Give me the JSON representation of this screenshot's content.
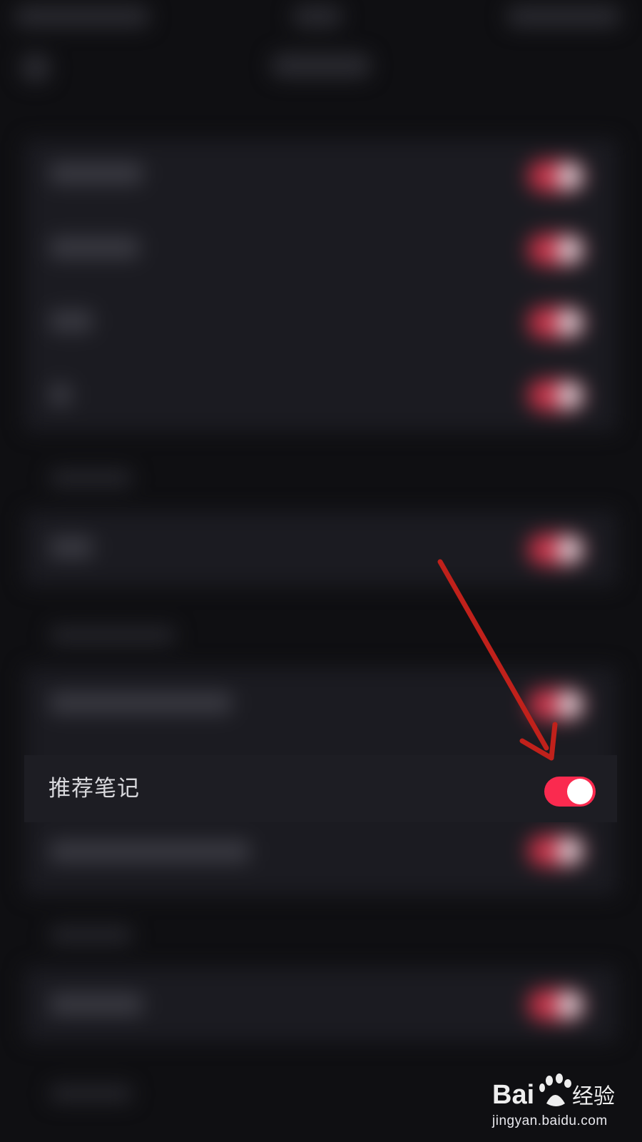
{
  "settings_row": {
    "label": "推荐笔记",
    "enabled": true
  },
  "toggle_color": "#fa2a4f",
  "annotation": {
    "color": "#c0211b",
    "icon": "arrow-icon"
  },
  "watermark": {
    "logo_text": "Bai 经验",
    "caption": "jingyan.baidu.com"
  }
}
